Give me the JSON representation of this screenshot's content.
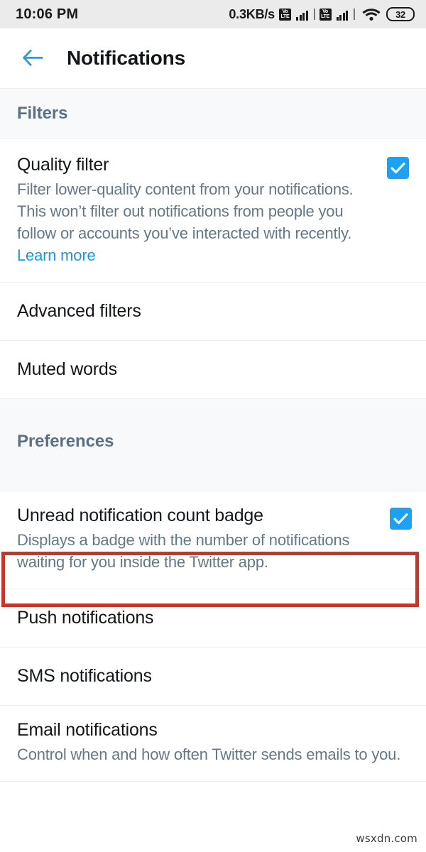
{
  "status_bar": {
    "clock": "10:06 PM",
    "net_speed": "0.3KB/s",
    "volte_label_top": "Vo",
    "volte_label_bottom": "LTE",
    "sim1_icon": "volte-signal-icon",
    "sim2_icon": "volte-signal-icon",
    "wifi_icon": "wifi-icon",
    "battery_level": "32"
  },
  "app_bar": {
    "back_icon": "back-arrow-icon",
    "title": "Notifications"
  },
  "sections": [
    {
      "header": "Filters",
      "rows": [
        {
          "title": "Quality filter",
          "desc_main": "Filter lower-quality content from your notifications. This won’t filter out notifications from people you follow or accounts you’ve interacted with recently. ",
          "desc_link": "Learn more",
          "checkbox": true
        },
        {
          "title": "Advanced filters"
        },
        {
          "title": "Muted words"
        }
      ]
    },
    {
      "header": "Preferences",
      "rows": [
        {
          "title": "Unread notification count badge",
          "desc_main": "Displays a badge with the number of notifications waiting for you inside the Twitter app.",
          "checkbox": true
        },
        {
          "title": "Push notifications",
          "highlighted": true
        },
        {
          "title": "SMS notifications"
        },
        {
          "title": "Email notifications",
          "desc_main": "Control when and how often Twitter sends emails to you."
        }
      ]
    }
  ],
  "annotation": {
    "target": "Push notifications",
    "color": "#c0392b"
  },
  "watermark": "wsxdn.com",
  "colors": {
    "accent_blue": "#1da1f2",
    "link_blue": "#1b95e0",
    "section_bg": "#f7f9fa",
    "section_label": "#5b7083",
    "primary_text": "#14171a",
    "secondary_text": "#657786",
    "divider": "#eceef0",
    "status_bg": "#ebebeb"
  }
}
